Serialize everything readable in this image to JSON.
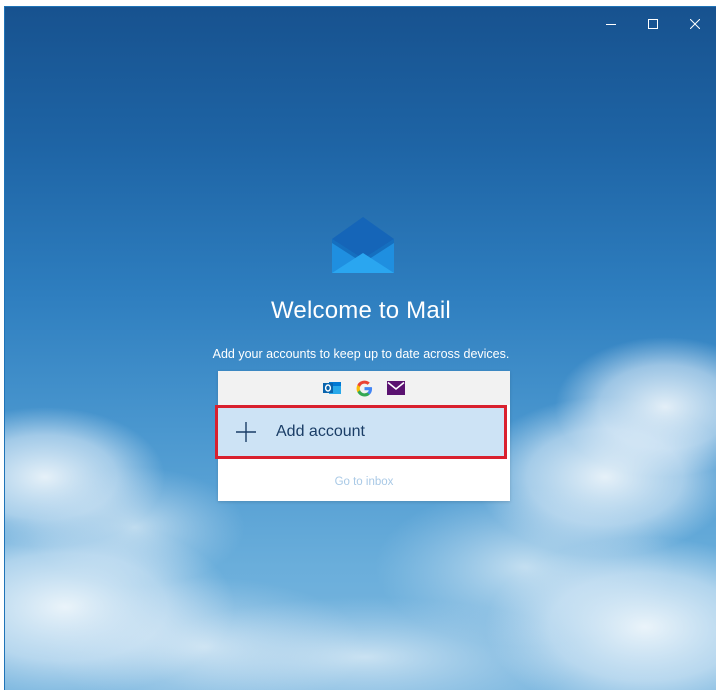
{
  "window": {
    "caption_buttons": {
      "minimize_icon": "minimize-icon",
      "maximize_icon": "maximize-icon",
      "close_icon": "close-icon"
    }
  },
  "welcome": {
    "logo_icon": "mail-envelope-icon",
    "title": "Welcome to Mail",
    "subtitle": "Add your accounts to keep up to date across devices."
  },
  "providers": [
    {
      "icon": "outlook-icon",
      "color": "#0a64ad"
    },
    {
      "icon": "google-icon",
      "color": "#4285f4"
    },
    {
      "icon": "other-mail-icon",
      "color": "#5a1270"
    }
  ],
  "actions": {
    "add_account_label": "Add account",
    "go_to_inbox_label": "Go to inbox"
  },
  "colors": {
    "highlight_border": "#d9202e",
    "add_account_bg": "#cde3f5"
  }
}
